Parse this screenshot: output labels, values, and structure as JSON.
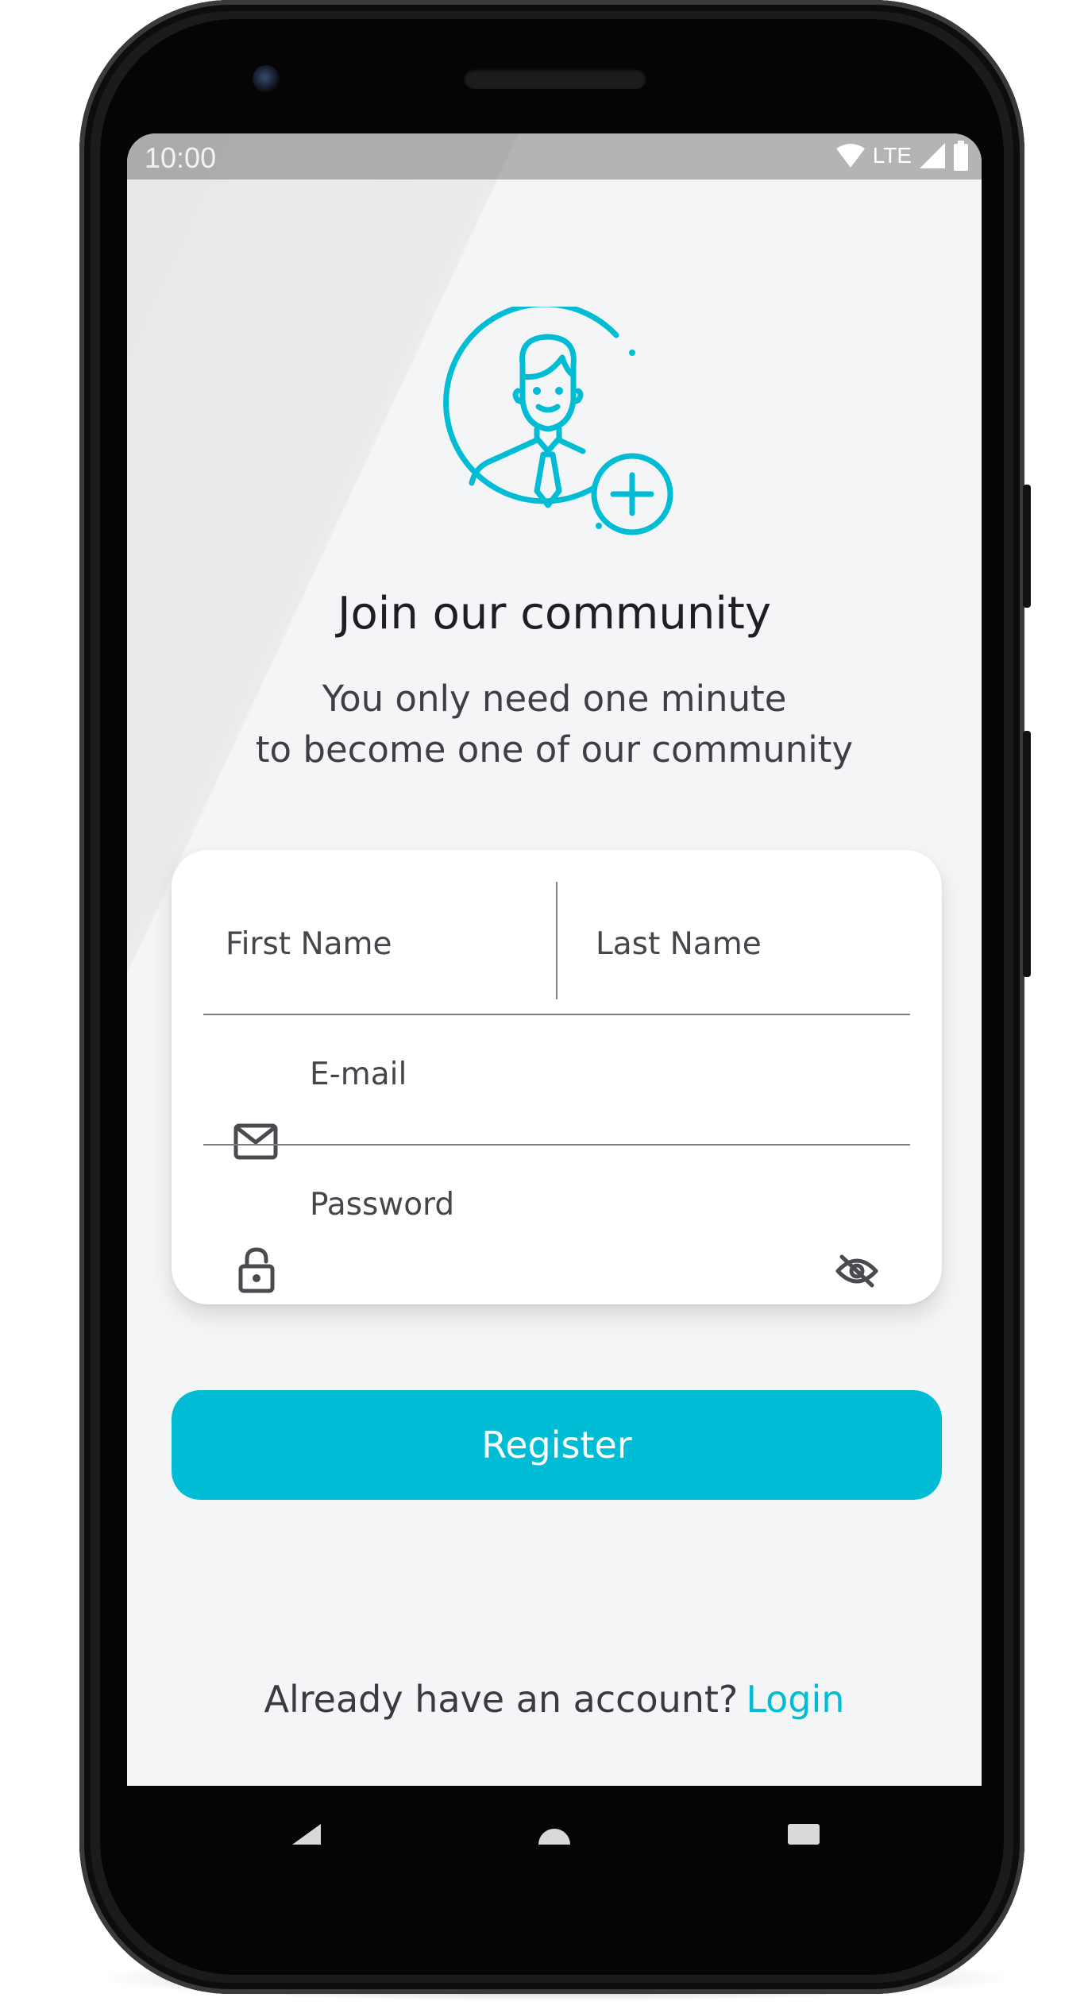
{
  "status_bar": {
    "time": "10:00",
    "network": "LTE",
    "icons": [
      "wifi-icon",
      "signal-icon",
      "battery-icon"
    ]
  },
  "hero": {
    "icon": "user-add-icon"
  },
  "title": "Join our community",
  "subtitle": {
    "line1": "You only need one minute",
    "line2": "to become one of our community"
  },
  "form": {
    "first_name": {
      "placeholder": "First Name",
      "value": ""
    },
    "last_name": {
      "placeholder": "Last Name",
      "value": ""
    },
    "email": {
      "placeholder": "E-mail",
      "value": "",
      "icon": "mail-icon"
    },
    "password": {
      "placeholder": "Password",
      "value": "",
      "icon": "lock-icon",
      "toggle_icon": "eye-off-icon"
    }
  },
  "register_button": {
    "label": "Register"
  },
  "footer": {
    "prompt": "Already have an account?",
    "link": "Login"
  },
  "nav_bar": {
    "icons": [
      "back-icon",
      "home-icon",
      "recents-icon"
    ]
  },
  "colors": {
    "accent": "#00bcd4",
    "background": "#f4f5f7",
    "card": "#ffffff",
    "status_bar": "#b3b4b6"
  }
}
